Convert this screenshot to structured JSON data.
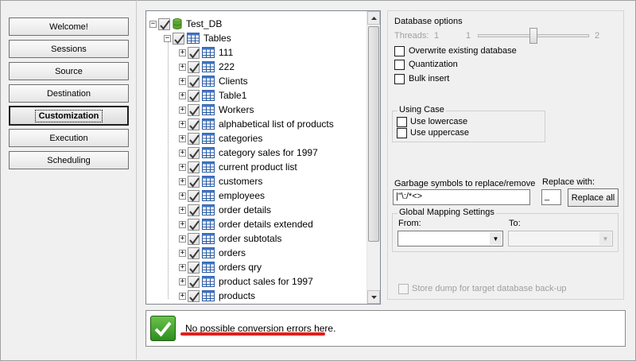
{
  "nav": {
    "items": [
      {
        "label": "Welcome!",
        "active": false
      },
      {
        "label": "Sessions",
        "active": false
      },
      {
        "label": "Source",
        "active": false
      },
      {
        "label": "Destination",
        "active": false
      },
      {
        "label": "Customization",
        "active": true
      },
      {
        "label": "Execution",
        "active": false
      },
      {
        "label": "Scheduling",
        "active": false
      }
    ]
  },
  "tree": {
    "root": {
      "label": "Test_DB",
      "expander": "−",
      "icon": "database-icon"
    },
    "tables_node": {
      "label": "Tables",
      "expander": "−",
      "icon": "table-icon"
    },
    "table_expander": "+",
    "tables": [
      "111",
      "222",
      "Clients",
      "Table1",
      "Workers",
      "alphabetical list of products",
      "categories",
      "category sales for 1997",
      "current product list",
      "customers",
      "employees",
      "order details",
      "order details extended",
      "order subtotals",
      "orders",
      "orders qry",
      "product sales for 1997",
      "products"
    ]
  },
  "database_options": {
    "title": "Database options",
    "threads_label": "Threads:",
    "threads_min": "1",
    "threads_value": "1",
    "threads_max": "2",
    "threads_level": 0.5,
    "overwrite_label": "Overwrite existing database",
    "overwrite_checked": false,
    "quantization_label": "Quantization",
    "quantization_checked": false,
    "bulk_insert_label": "Bulk insert",
    "bulk_insert_checked": false
  },
  "using_case": {
    "title": "Using Case",
    "lowercase_label": "Use lowercase",
    "uppercase_label": "Use uppercase"
  },
  "garbage": {
    "label": "Garbage symbols to replace/remove",
    "value": "|\"\\:/*<>",
    "replace_with_label": "Replace with:",
    "replace_with_value": "_",
    "replace_all_label": "Replace all"
  },
  "mapping": {
    "title": "Global Mapping Settings",
    "from_label": "From:",
    "to_label": "To:",
    "from_value": "",
    "to_value": ""
  },
  "store_dump": {
    "label": "Store dump for target database back-up",
    "enabled": false
  },
  "status": {
    "message": "No possible conversion errors here.",
    "icon": "check-icon",
    "accent": "#e0201e"
  }
}
